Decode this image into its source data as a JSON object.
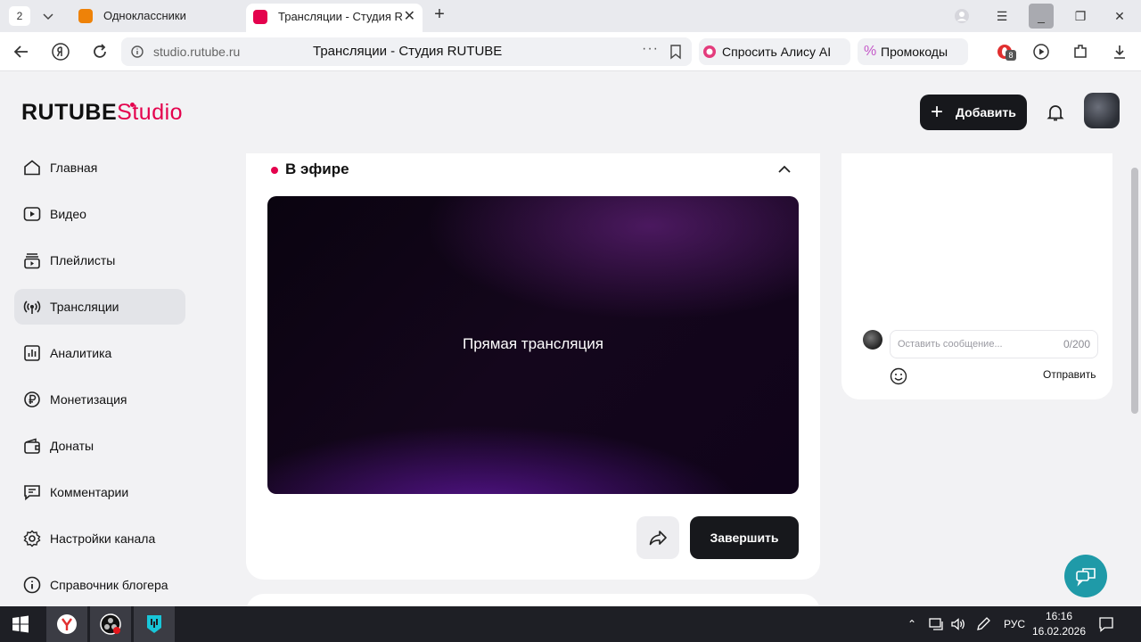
{
  "browser": {
    "tab_count": "2",
    "tabs": [
      {
        "label": "Одноклассники",
        "active": false
      },
      {
        "label": "Трансляции - Студия R",
        "active": true
      }
    ],
    "url": "studio.rutube.ru",
    "page_title": "Трансляции - Студия RUTUBE",
    "alice_label": "Спросить Алису AI",
    "promo_label": "Промокоды",
    "ext_badge": "8"
  },
  "header": {
    "logo_main": "RUTUBE",
    "logo_studio": "Studio",
    "add_label": "Добавить"
  },
  "sidebar": {
    "items": [
      {
        "label": "Главная",
        "icon": "home-icon"
      },
      {
        "label": "Видео",
        "icon": "video-icon"
      },
      {
        "label": "Плейлисты",
        "icon": "playlist-icon"
      },
      {
        "label": "Трансляции",
        "icon": "broadcast-icon",
        "selected": true
      },
      {
        "label": "Аналитика",
        "icon": "analytics-icon"
      },
      {
        "label": "Монетизация",
        "icon": "ruble-icon"
      },
      {
        "label": "Донаты",
        "icon": "wallet-icon"
      },
      {
        "label": "Комментарии",
        "icon": "comment-icon"
      },
      {
        "label": "Настройки канала",
        "icon": "gear-icon"
      },
      {
        "label": "Справочник блогера",
        "icon": "info-icon"
      }
    ]
  },
  "live": {
    "title": "В эфире",
    "player_text": "Прямая трансляция",
    "end_label": "Завершить"
  },
  "chat": {
    "placeholder": "Оставить сообщение...",
    "counter": "0/200",
    "send_label": "Отправить"
  },
  "taskbar": {
    "lang": "РУС",
    "time": "16:16",
    "date": "16.02.2026"
  },
  "colors": {
    "accent": "#e4024d",
    "dark_button": "#17181c",
    "help_button": "#1f9aa8"
  }
}
